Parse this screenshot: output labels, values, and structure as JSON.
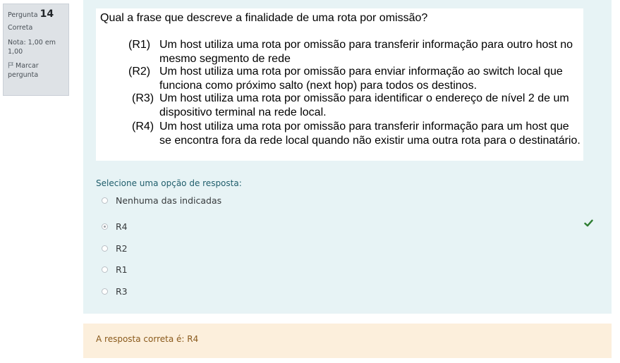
{
  "info": {
    "question_label": "Pergunta",
    "question_number": "14",
    "state": "Correta",
    "grade": "Nota: 1,00 em 1,00",
    "flag_label": "Marcar pergunta"
  },
  "question": {
    "title": "Qual a frase que descreve a finalidade de uma rota por omissão?",
    "statements": [
      {
        "tag": "(R1)",
        "text": "Um host utiliza uma rota por omissão para transferir informação para outro host no mesmo segmento de rede"
      },
      {
        "tag": "(R2)",
        "text": "Um host utiliza uma rota por omissão para enviar informação ao switch local que funciona como próximo salto (next hop) para todos os destinos."
      },
      {
        "tag": "(R3)",
        "text": "Um host utiliza uma rota por omissão para identificar o endereço de nível 2 de um dispositivo terminal na rede local."
      },
      {
        "tag": "(R4)",
        "text": "Um host utiliza uma rota por omissão para transferir informação para um host que se encontra fora da rede local quando não existir uma outra rota para o destinatário."
      }
    ]
  },
  "answer": {
    "prompt": "Selecione uma opção de resposta:",
    "options": [
      {
        "label": "Nenhuma das indicadas",
        "selected": false
      },
      {
        "label": "R4",
        "selected": true
      },
      {
        "label": "R2",
        "selected": false
      },
      {
        "label": "R1",
        "selected": false
      },
      {
        "label": "R3",
        "selected": false
      }
    ],
    "correct_icon": "check-icon",
    "correct_color": "#2e7d32"
  },
  "feedback": {
    "text": "A resposta correta é: R4"
  },
  "colors": {
    "question_bg": "#e7f3f5",
    "feedback_bg": "#fcefdc",
    "info_bg": "#dee2e6"
  }
}
